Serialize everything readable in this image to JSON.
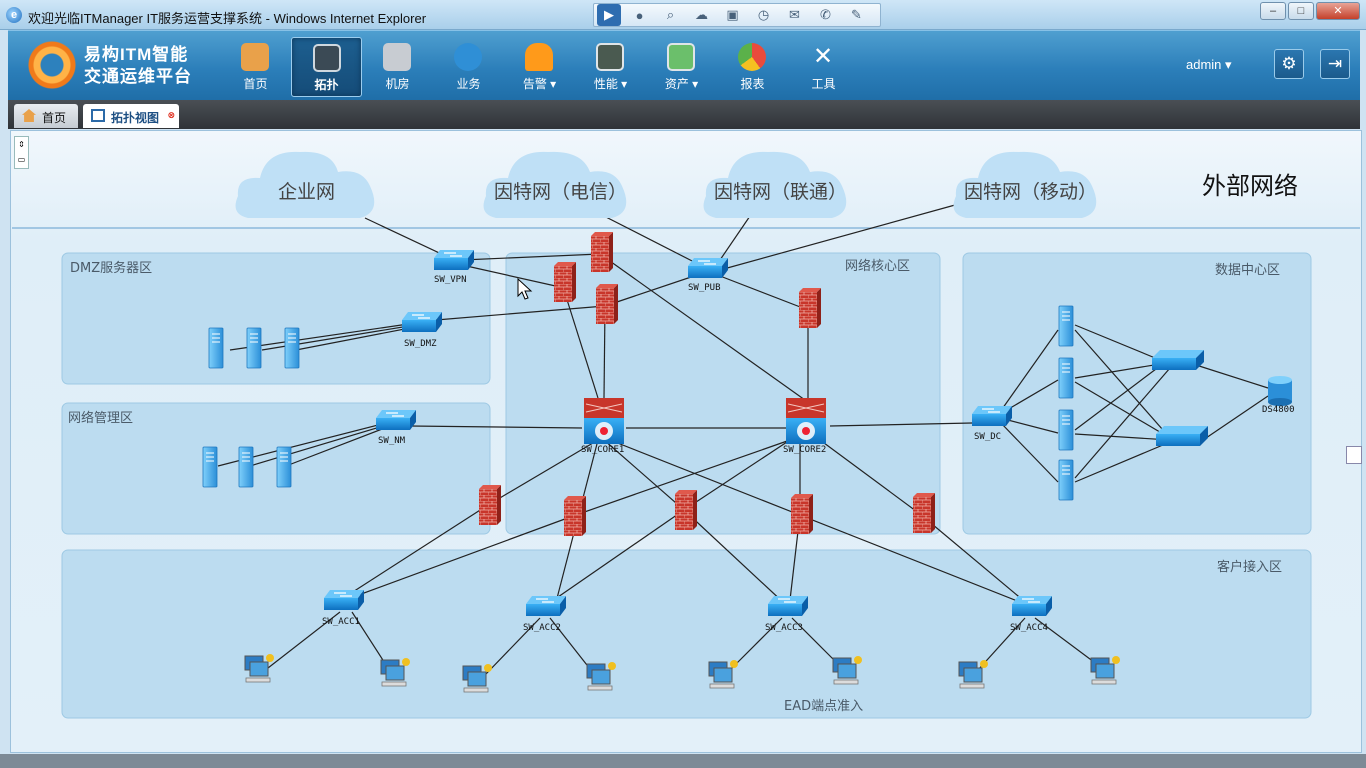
{
  "window": {
    "title": "欢迎光临ITManager IT服务运营支撑系统 - Windows Internet Explorer"
  },
  "app": {
    "logo_line1": "易构ITM智能",
    "logo_line2": "交通运维平台",
    "user": "admin",
    "nav": [
      {
        "label": "首页",
        "icon": "home-icon",
        "color": "#e9a14a"
      },
      {
        "label": "拓扑",
        "icon": "topology-icon",
        "color": "#3b4a55"
      },
      {
        "label": "机房",
        "icon": "server-room-icon",
        "color": "#c8ccd2"
      },
      {
        "label": "业务",
        "icon": "globe-icon",
        "color": "#2f8fd6"
      },
      {
        "label": "告警",
        "icon": "alarm-icon",
        "color": "#ff9a1a",
        "dropdown": true
      },
      {
        "label": "性能",
        "icon": "performance-monitor-icon",
        "color": "#4a5a50",
        "dropdown": true
      },
      {
        "label": "资产",
        "icon": "assets-icon",
        "color": "#6bbf6b",
        "dropdown": true
      },
      {
        "label": "报表",
        "icon": "pie-report-icon",
        "color": "#e94b3c"
      },
      {
        "label": "工具",
        "icon": "tools-icon",
        "color": "#b9c8d6"
      }
    ]
  },
  "tabs": [
    {
      "label": "首页",
      "icon": "home-icon"
    },
    {
      "label": "拓扑视图",
      "icon": "topology-view-icon",
      "active": true
    }
  ],
  "topology": {
    "title": "外部网络",
    "clouds": [
      "企业网",
      "因特网（电信）",
      "因特网（联通）",
      "因特网（移动）"
    ],
    "zones": {
      "dmz": "DMZ服务器区",
      "mgmt": "网络管理区",
      "core": "网络核心区",
      "dc": "数据中心区",
      "access": "客户接入区",
      "ead": "EAD端点准入"
    },
    "devices": {
      "sw_vpn": "SW_VPN",
      "sw_pub": "SW_PUB",
      "sw_dmz": "SW_DMZ",
      "sw_nm": "SW_NM",
      "sw_dc": "SW_DC",
      "sw_core1": "SW_CORE1",
      "sw_core2": "SW_CORE2",
      "storage": "DS4800",
      "sw_acc1": "SW_ACC1",
      "sw_acc2": "SW_ACC2",
      "sw_acc3": "SW_ACC3",
      "sw_acc4": "SW_ACC4"
    }
  },
  "colors": {
    "switch": "#1a8fe0",
    "firewall": "#c8352a",
    "server": "#4fb3ee",
    "zone": "#bcdcf0"
  }
}
